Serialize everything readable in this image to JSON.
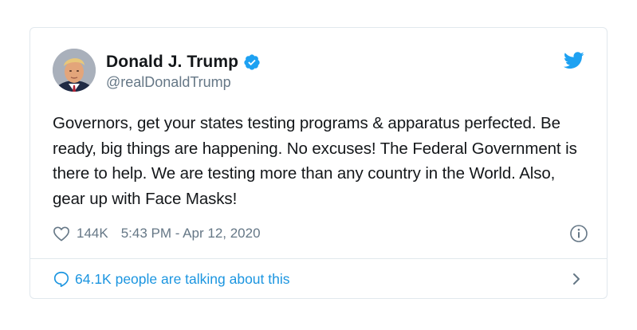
{
  "tweet": {
    "author": {
      "name": "Donald J. Trump",
      "handle": "@realDonaldTrump",
      "verified": true,
      "avatar_icon": "user-avatar-photo"
    },
    "text": "Governors, get your states testing programs & apparatus perfected. Be ready, big things are happening. No excuses! The Federal Government is there to help. We are testing more than any country in the World. Also, gear up with Face Masks!",
    "likes": "144K",
    "timestamp": "5:43 PM - Apr 12, 2020",
    "conversation": "64.1K people are talking about this"
  },
  "icons": {
    "brand": "twitter-bird-icon",
    "verified": "verified-badge-icon",
    "like": "heart-icon",
    "info": "info-icon",
    "reply": "speech-bubble-icon",
    "more": "chevron-right-icon"
  },
  "colors": {
    "brand_blue": "#1da1f2",
    "link_blue": "#1b95e0",
    "text": "#14171a",
    "secondary": "#657786",
    "border": "#e1e8ed"
  }
}
